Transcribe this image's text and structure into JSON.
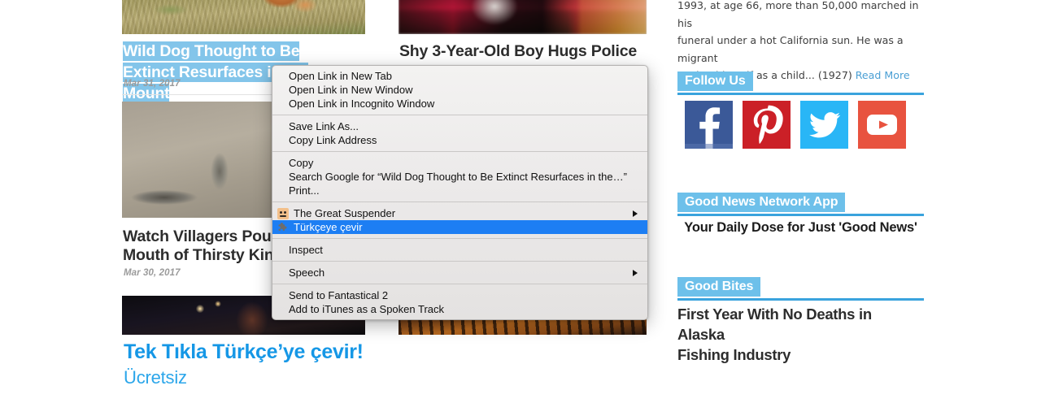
{
  "page": {
    "background": "#ffffff",
    "accent_blue": "#3aa3dd",
    "highlight_blue": "#1d7ef3",
    "selection_blue": "#83c5ea"
  },
  "articles": [
    {
      "headline": "Wild Dog Thought to Be Extinct Resurfaces in the Mountains",
      "headline_visible": "Wild Dog Thought to Be Extinct Resurfaces in the Mount",
      "date": "Mar 31, 2017",
      "image": "wild-dog-in-grass",
      "selected": true
    },
    {
      "headline": "Shy 3-Year-Old Boy Hugs Police Officer:",
      "date": "",
      "image": "blurry-office-interior",
      "selected": false
    },
    {
      "headline_line1": "Watch Villagers Pour Wa",
      "headline_line2": "Mouth of Thirsty King Co",
      "date": "Mar 30, 2017",
      "image": "cobra-drinking-water",
      "selected": false
    },
    {
      "headline": "",
      "date": "",
      "image": "dark-night-scene",
      "selected": false
    },
    {
      "headline": "",
      "date": "",
      "image": "tiger-stripes",
      "selected": false
    }
  ],
  "context_menu": {
    "groups": [
      {
        "items": [
          {
            "label": "Open Link in New Tab",
            "icon": null,
            "submenu": false,
            "highlighted": false
          },
          {
            "label": "Open Link in New Window",
            "icon": null,
            "submenu": false,
            "highlighted": false
          },
          {
            "label": "Open Link in Incognito Window",
            "icon": null,
            "submenu": false,
            "highlighted": false
          }
        ]
      },
      {
        "items": [
          {
            "label": "Save Link As...",
            "icon": null,
            "submenu": false,
            "highlighted": false
          },
          {
            "label": "Copy Link Address",
            "icon": null,
            "submenu": false,
            "highlighted": false
          }
        ]
      },
      {
        "items": [
          {
            "label": "Copy",
            "icon": null,
            "submenu": false,
            "highlighted": false
          },
          {
            "label": "Search Google for “Wild Dog Thought to Be Extinct Resurfaces in the…”",
            "icon": null,
            "submenu": false,
            "highlighted": false
          },
          {
            "label": "Print...",
            "icon": null,
            "submenu": false,
            "highlighted": false
          }
        ]
      },
      {
        "items": [
          {
            "label": "The Great Suspender",
            "icon": "suspender-icon",
            "submenu": true,
            "highlighted": false
          },
          {
            "label": "Türkçeye çevir",
            "icon": "puzzle-piece-icon",
            "submenu": false,
            "highlighted": true
          }
        ]
      },
      {
        "items": [
          {
            "label": "Inspect",
            "icon": null,
            "submenu": false,
            "highlighted": false
          }
        ]
      },
      {
        "items": [
          {
            "label": "Speech",
            "icon": null,
            "submenu": true,
            "highlighted": false
          }
        ]
      },
      {
        "items": [
          {
            "label": "Send to Fantastical 2",
            "icon": null,
            "submenu": false,
            "highlighted": false
          },
          {
            "label": "Add to iTunes as a Spoken Track",
            "icon": null,
            "submenu": false,
            "highlighted": false
          }
        ]
      }
    ]
  },
  "sidebar": {
    "excerpt": {
      "line1": "1993, at age 66, more than 50,000 marched in his",
      "line2": "funeral under a hot California sun. He was a migrant",
      "line3": "worker himself as a child... (1927) ",
      "read_more": "Read More"
    },
    "widgets": [
      {
        "title": "Follow Us",
        "socials": [
          {
            "name": "facebook",
            "color": "#3b5998"
          },
          {
            "name": "pinterest",
            "color": "#cb2027"
          },
          {
            "name": "twitter",
            "color": "#29b6f6"
          },
          {
            "name": "youtube",
            "color": "#e8533f"
          }
        ]
      },
      {
        "title": "Good News Network App",
        "tagline": "Your Daily Dose for Just 'Good News'"
      },
      {
        "title": "Good Bites",
        "item_line1": "First Year With No Deaths in Alaska",
        "item_line2": "Fishing Industry"
      }
    ]
  },
  "promo": {
    "title": "Tek Tıkla Türkçe’ye çevir!",
    "subtitle": "Ücretsiz"
  }
}
